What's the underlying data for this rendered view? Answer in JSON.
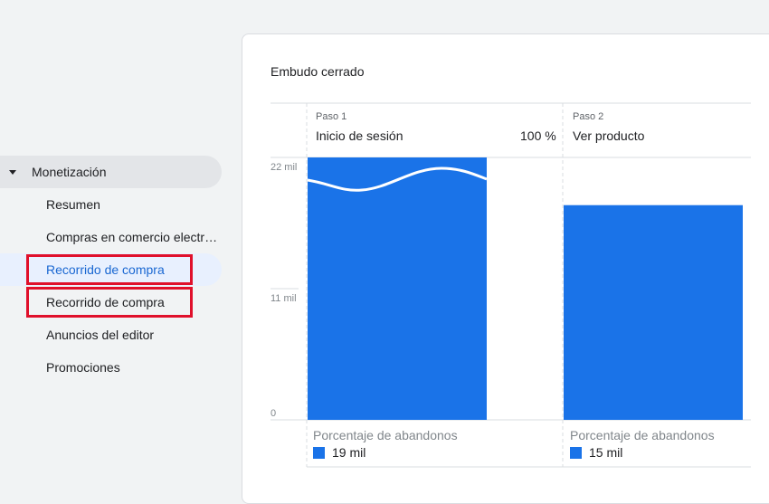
{
  "sidebar": {
    "group_label": "Monetización",
    "items": [
      {
        "label": "Resumen"
      },
      {
        "label": "Compras en comercio electrónico"
      },
      {
        "label": "Recorrido de compra"
      },
      {
        "label": "Recorrido de compra"
      },
      {
        "label": "Anuncios del editor"
      },
      {
        "label": "Promociones"
      }
    ]
  },
  "card": {
    "title": "Embudo cerrado"
  },
  "colors": {
    "bar": "#1a73e8",
    "highlight": "#e0102b",
    "active_text": "#1967d2"
  },
  "chart_data": {
    "type": "bar",
    "categories": [
      "Inicio de sesión",
      "Ver producto"
    ],
    "step_labels": [
      "Paso 1",
      "Paso 2"
    ],
    "values": [
      22000,
      18000
    ],
    "step1_percent": "100 %",
    "y_ticks": [
      "22 mil",
      "11 mil",
      "0"
    ],
    "ylim": [
      0,
      22000
    ],
    "abandon_title": "Porcentaje de abandonos",
    "abandon_values": [
      "19 mil",
      "15 mil"
    ]
  }
}
